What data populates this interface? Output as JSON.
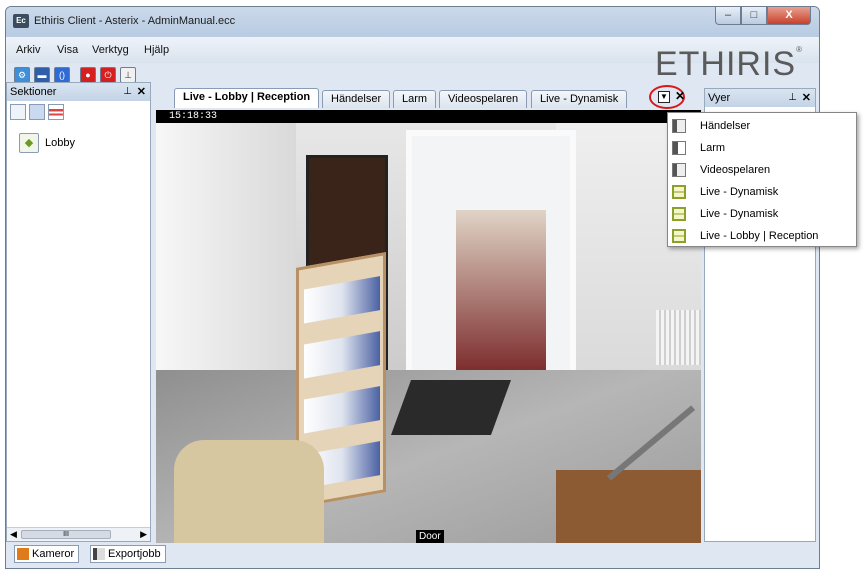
{
  "window": {
    "title": "Ethiris Client - Asterix - AdminManual.ecc",
    "app_icon_text": "Ec",
    "controls": [
      "–",
      "□",
      "X"
    ]
  },
  "menu": [
    "Arkiv",
    "Visa",
    "Verktyg",
    "Hjälp"
  ],
  "brand": "ETHIRIS",
  "left_panel": {
    "title": "Sektioner",
    "items": [
      {
        "label": "Lobby"
      }
    ],
    "scroll_thumb": "III"
  },
  "right_panel": {
    "title": "Vyer"
  },
  "tabs": [
    {
      "label": "Live - Lobby | Reception",
      "active": true
    },
    {
      "label": "Händelser"
    },
    {
      "label": "Larm"
    },
    {
      "label": "Videospelaren"
    },
    {
      "label": "Live - Dynamisk"
    }
  ],
  "video": {
    "timestamp": "15:18:33",
    "camera_label": "Door"
  },
  "dropdown": {
    "items": [
      {
        "label": "Händelser",
        "icon": "events-icon"
      },
      {
        "label": "Larm",
        "icon": "alarm-icon"
      },
      {
        "label": "Videospelaren",
        "icon": "video-player-icon"
      },
      {
        "label": "Live - Dynamisk",
        "icon": "layout-grid-icon"
      },
      {
        "label": "Live - Dynamisk",
        "icon": "layout-grid-icon"
      },
      {
        "label": "Live - Lobby | Reception",
        "icon": "layout-grid-icon"
      }
    ]
  },
  "bottom_tabs": [
    {
      "label": "Kameror",
      "icon": "camera-icon"
    },
    {
      "label": "Exportjobb",
      "icon": "export-icon"
    }
  ],
  "colors": {
    "highlight_circle": "#d81818",
    "titlebar": "#b8cbe2",
    "close_button": "#c8402a"
  }
}
